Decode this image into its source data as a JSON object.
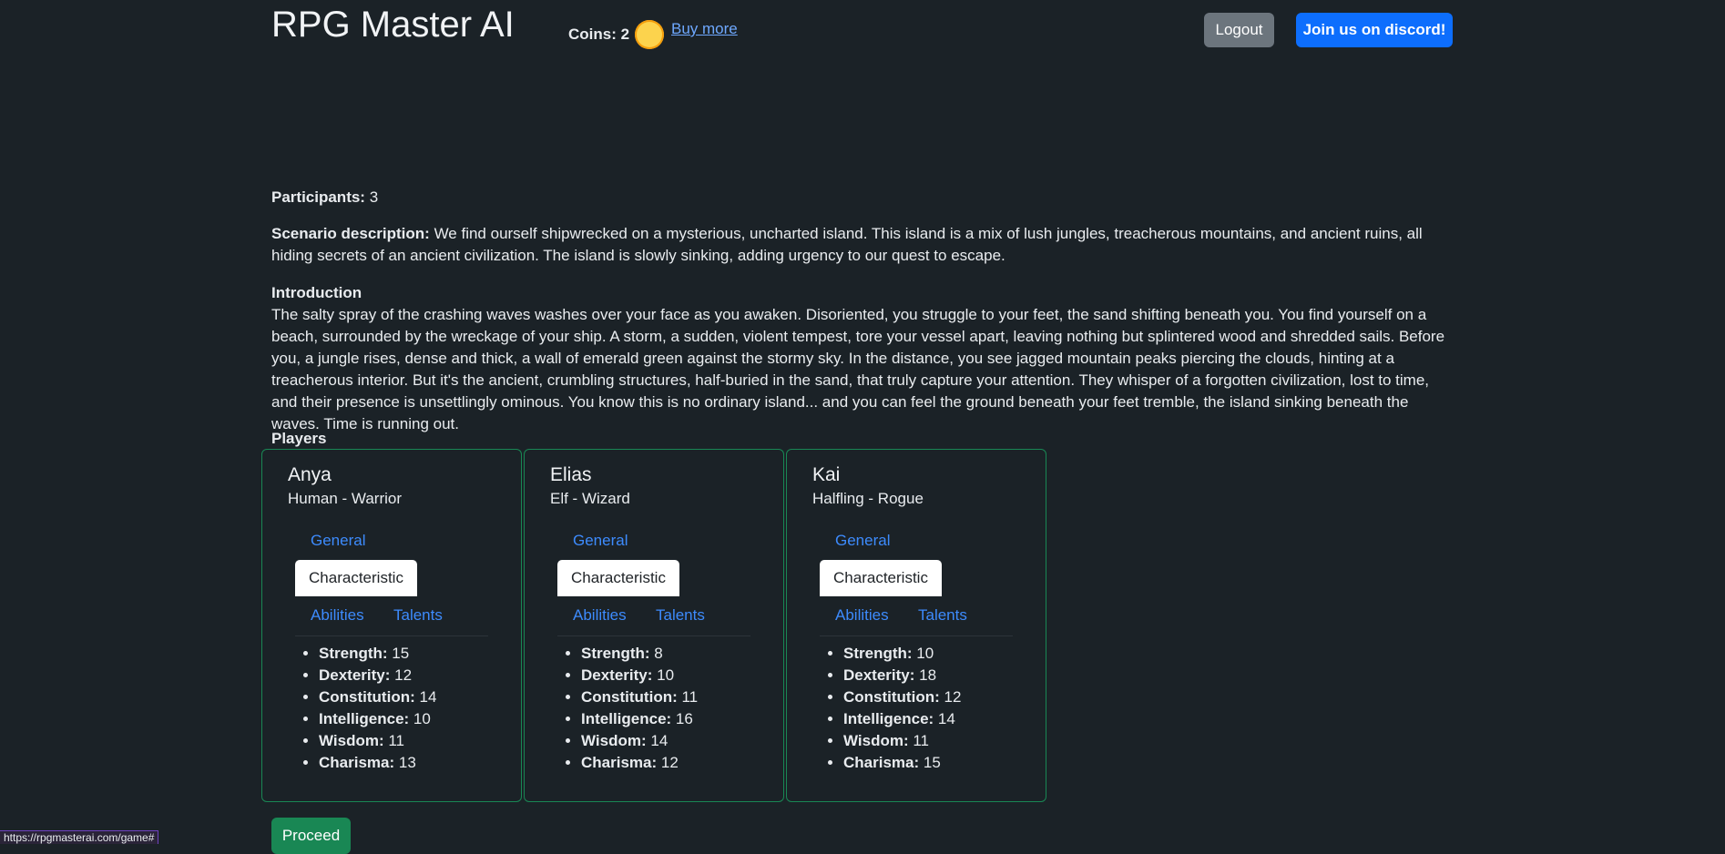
{
  "header": {
    "title": "RPG Master AI",
    "coins_label": "Coins: 2",
    "coin_icon": "coin-icon",
    "buy_more": "Buy more",
    "logout": "Logout",
    "discord": "Join us on discord!"
  },
  "participants": {
    "label": "Participants:",
    "value": "3"
  },
  "scenario": {
    "label": "Scenario description:",
    "text": "We find ourself shipwrecked on a mysterious, uncharted island. This island is a mix of lush jungles, treacherous mountains, and ancient ruins, all hiding secrets of an ancient civilization. The island is slowly sinking, adding urgency to our quest to escape."
  },
  "introduction": {
    "heading": "Introduction",
    "text": "The salty spray of the crashing waves washes over your face as you awaken. Disoriented, you struggle to your feet, the sand shifting beneath you. You find yourself on a beach, surrounded by the wreckage of your ship. A storm, a sudden, violent tempest, tore your vessel apart, leaving nothing but splintered wood and shredded sails. Before you, a jungle rises, dense and thick, a wall of emerald green against the stormy sky. In the distance, you see jagged mountain peaks piercing the clouds, hinting at a treacherous interior. But it's the ancient, crumbling structures, half-buried in the sand, that truly capture your attention. They whisper of a forgotten civilization, lost to time, and their presence is unsettlingly ominous. You know this is no ordinary island... and you can feel the ground beneath your feet tremble, the island sinking beneath the waves. Time is running out."
  },
  "players_heading": "Players",
  "tabs": {
    "general": "General",
    "characteristic": "Characteristic",
    "abilities": "Abilities",
    "talents": "Talents"
  },
  "stat_labels": {
    "strength": "Strength:",
    "dexterity": "Dexterity:",
    "constitution": "Constitution:",
    "intelligence": "Intelligence:",
    "wisdom": "Wisdom:",
    "charisma": "Charisma:"
  },
  "players": [
    {
      "name": "Anya",
      "race_class": "Human - Warrior",
      "strength": "15",
      "dexterity": "12",
      "constitution": "14",
      "intelligence": "10",
      "wisdom": "11",
      "charisma": "13"
    },
    {
      "name": "Elias",
      "race_class": "Elf - Wizard",
      "strength": "8",
      "dexterity": "10",
      "constitution": "11",
      "intelligence": "16",
      "wisdom": "14",
      "charisma": "12"
    },
    {
      "name": "Kai",
      "race_class": "Halfling - Rogue",
      "strength": "10",
      "dexterity": "18",
      "constitution": "12",
      "intelligence": "14",
      "wisdom": "11",
      "charisma": "15"
    }
  ],
  "proceed": "Proceed",
  "status_url": "https://rpgmasterai.com/game#",
  "colors": {
    "background": "#1b2227",
    "card_border": "#198754",
    "link": "#3d8bfd",
    "primary": "#0d6efd",
    "success": "#198754",
    "secondary": "#6c757d"
  }
}
